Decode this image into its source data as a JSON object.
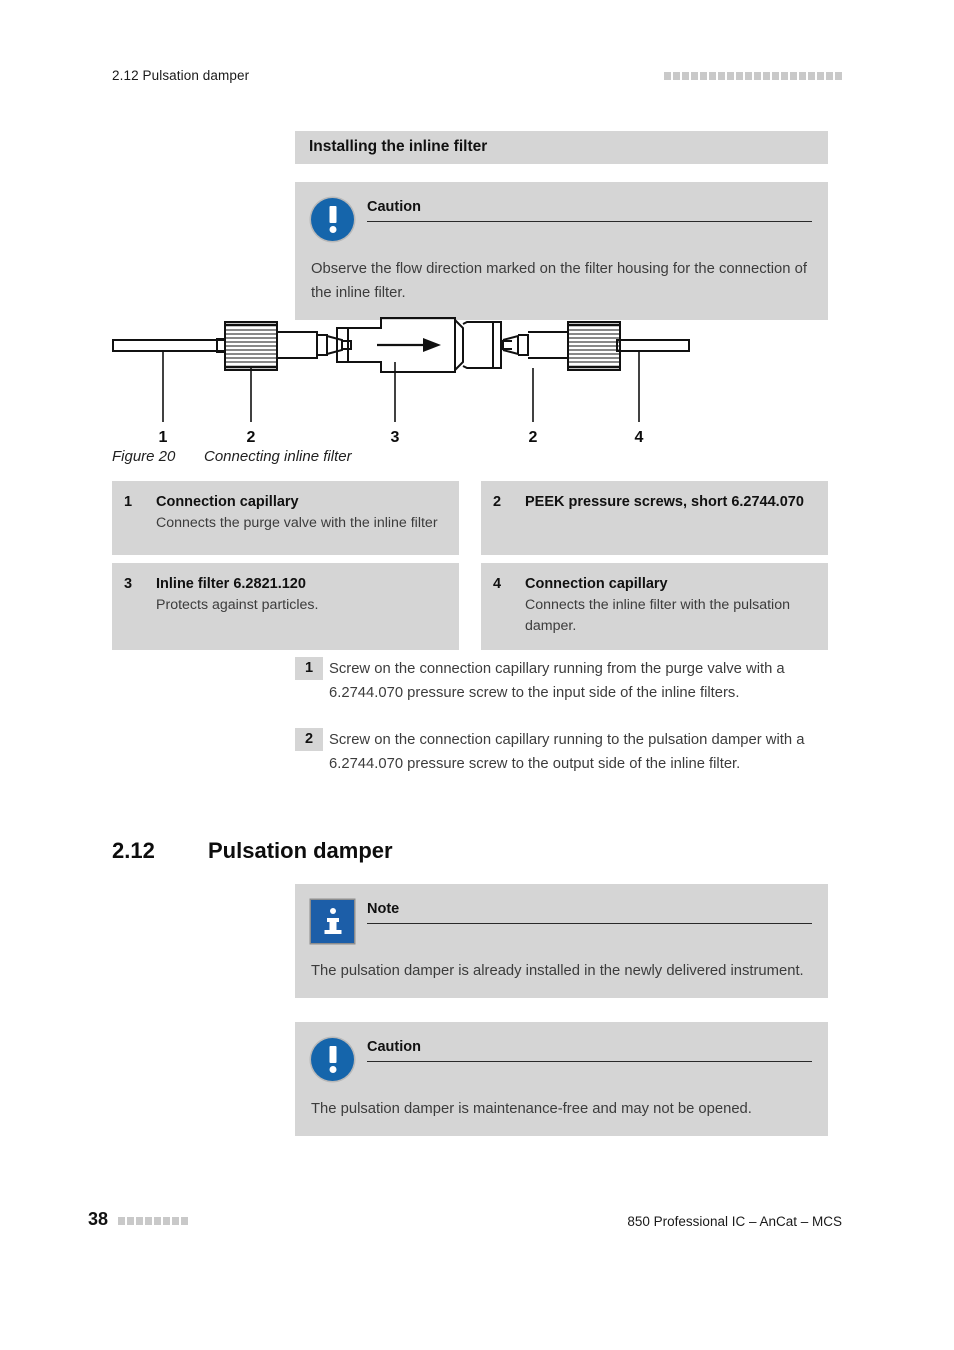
{
  "header": {
    "running_title": "2.12 Pulsation damper",
    "dot_count": 20
  },
  "section_band": {
    "title": "Installing the inline filter"
  },
  "caution_top": {
    "icon": "caution-circle-icon",
    "label": "Caution",
    "body": "Observe the flow direction marked on the filter housing for the connection of the inline filter."
  },
  "figure": {
    "callouts": [
      "1",
      "2",
      "3",
      "2",
      "4"
    ],
    "flow_arrow": "flow-direction-arrow",
    "caption_number": "Figure 20",
    "caption_text": "Connecting inline filter"
  },
  "legend": {
    "items": [
      {
        "num": "1",
        "title": "Connection capillary",
        "desc": "Connects the purge valve with the inline filter"
      },
      {
        "num": "2",
        "title": "PEEK pressure screws, short 6.2744.070",
        "desc": ""
      },
      {
        "num": "3",
        "title": "Inline filter 6.2821.120",
        "desc": "Protects against particles."
      },
      {
        "num": "4",
        "title": "Connection capillary",
        "desc": "Connects the inline filter with the pulsation damper."
      }
    ]
  },
  "steps": [
    {
      "num": "1",
      "text": "Screw on the connection capillary running from the purge valve with a 6.2744.070 pressure screw to the input side of the inline filters."
    },
    {
      "num": "2",
      "text": "Screw on the connection capillary running to the pulsation damper with a 6.2744.070 pressure screw to the output side of the inline filter."
    }
  ],
  "chapter": {
    "number": "2.12",
    "title": "Pulsation damper"
  },
  "note_box": {
    "icon": "info-square-icon",
    "label": "Note",
    "body": "The pulsation damper is already installed in the newly delivered instrument."
  },
  "caution_bottom": {
    "icon": "caution-circle-icon",
    "label": "Caution",
    "body": "The pulsation damper is maintenance-free and may not be opened."
  },
  "footer": {
    "page_number": "38",
    "dot_count": 8,
    "product": "850 Professional IC – AnCat – MCS"
  },
  "colors": {
    "panel_gray": "#d5d5d5",
    "dot_gray": "#c9c9c9",
    "icon_blue": "#1565ab",
    "text": "#3c3c3c"
  }
}
